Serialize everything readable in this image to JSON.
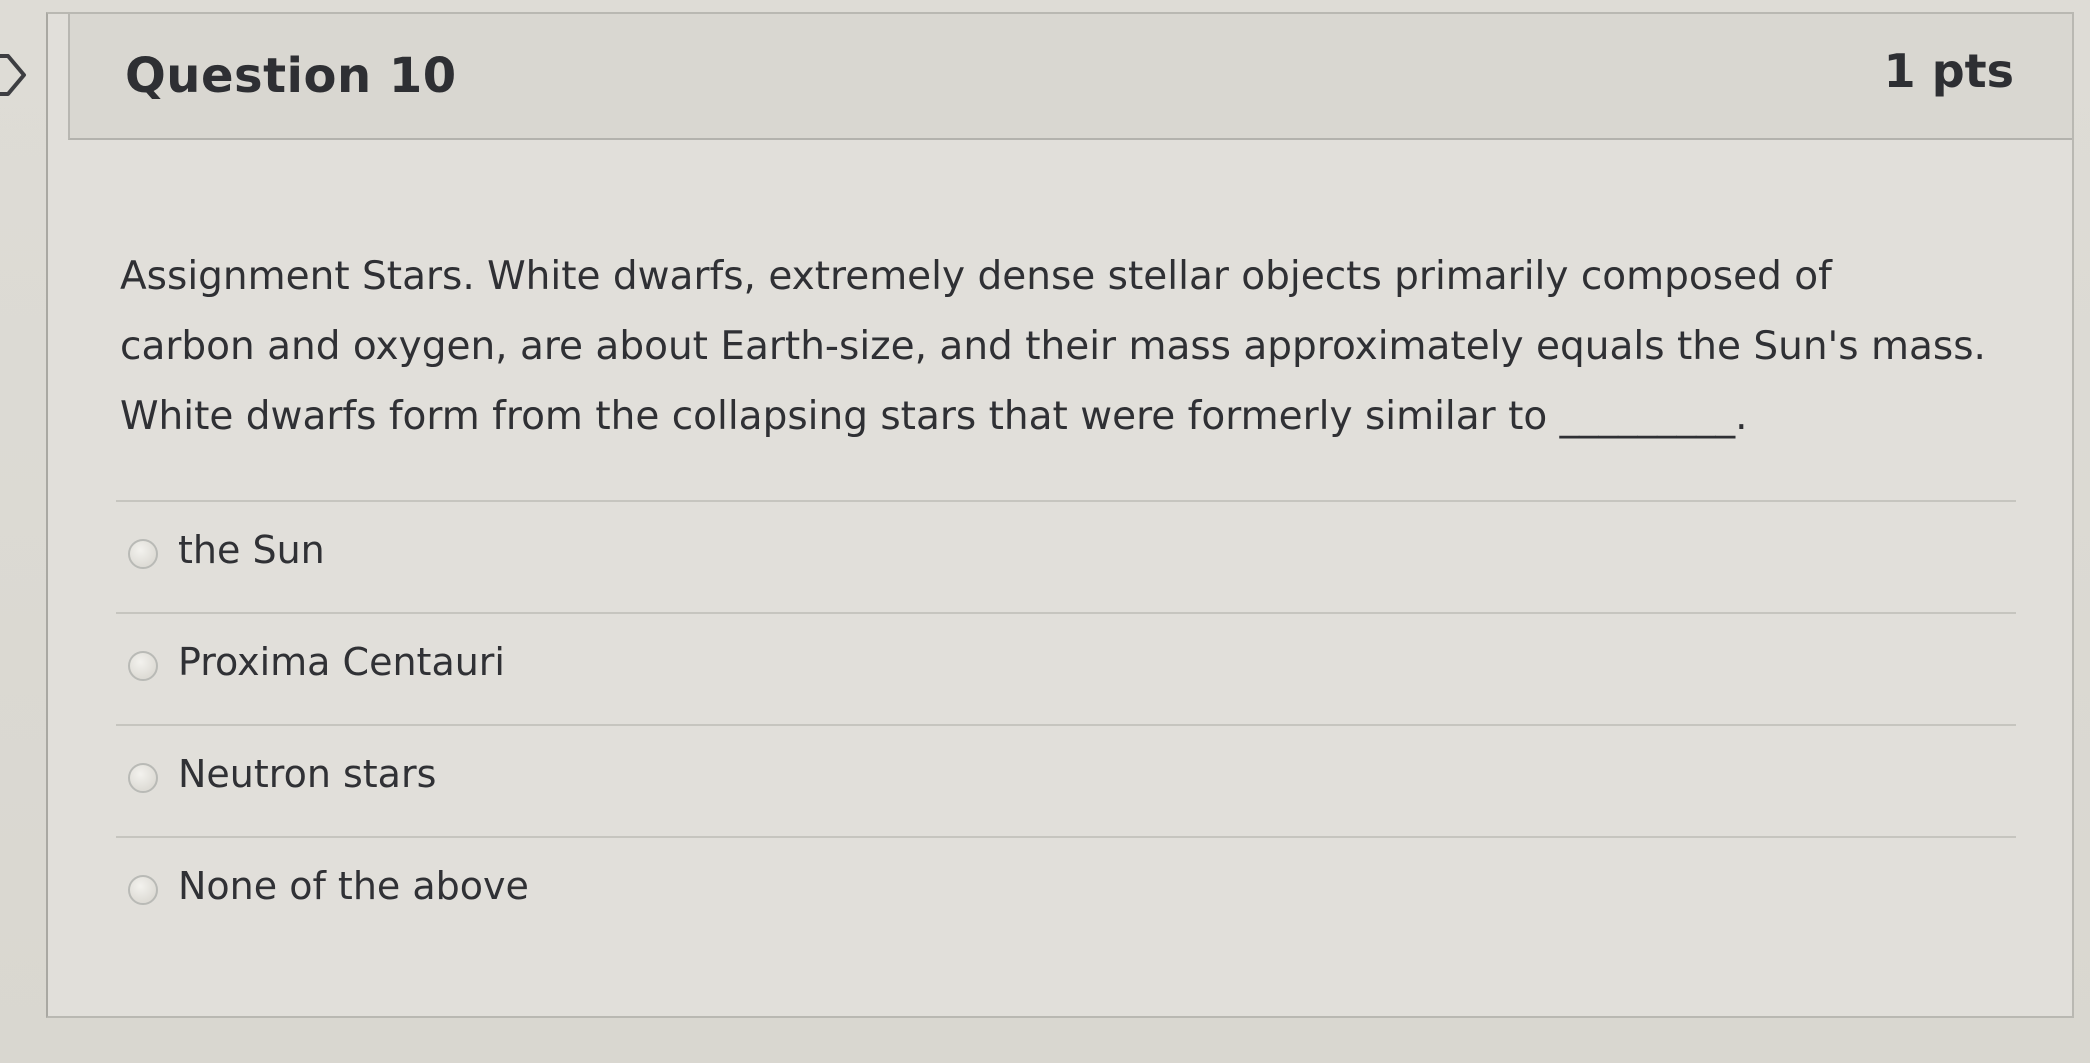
{
  "question": {
    "title": "Question 10",
    "points": "1 pts",
    "text_lines": [
      "Assignment Stars. White dwarfs, extremely dense stellar objects primarily composed of",
      "carbon and oxygen, are about Earth-size, and their mass approximately equals the Sun's mass.",
      "White dwarfs form from the collapsing stars that were formerly similar to _________."
    ]
  },
  "answers": [
    {
      "label": "the Sun",
      "selected": false
    },
    {
      "label": "Proxima Centauri",
      "selected": false
    },
    {
      "label": "Neutron stars",
      "selected": false
    },
    {
      "label": "None of the above",
      "selected": false
    }
  ],
  "icons": {
    "flag_marker": "bookmark-flag-icon",
    "radio": "radio-button-icon"
  },
  "colors": {
    "background": "#dcdbd5",
    "header": "#d9d7d1",
    "text": "#2e2f33",
    "border": "#b9b8b2"
  }
}
